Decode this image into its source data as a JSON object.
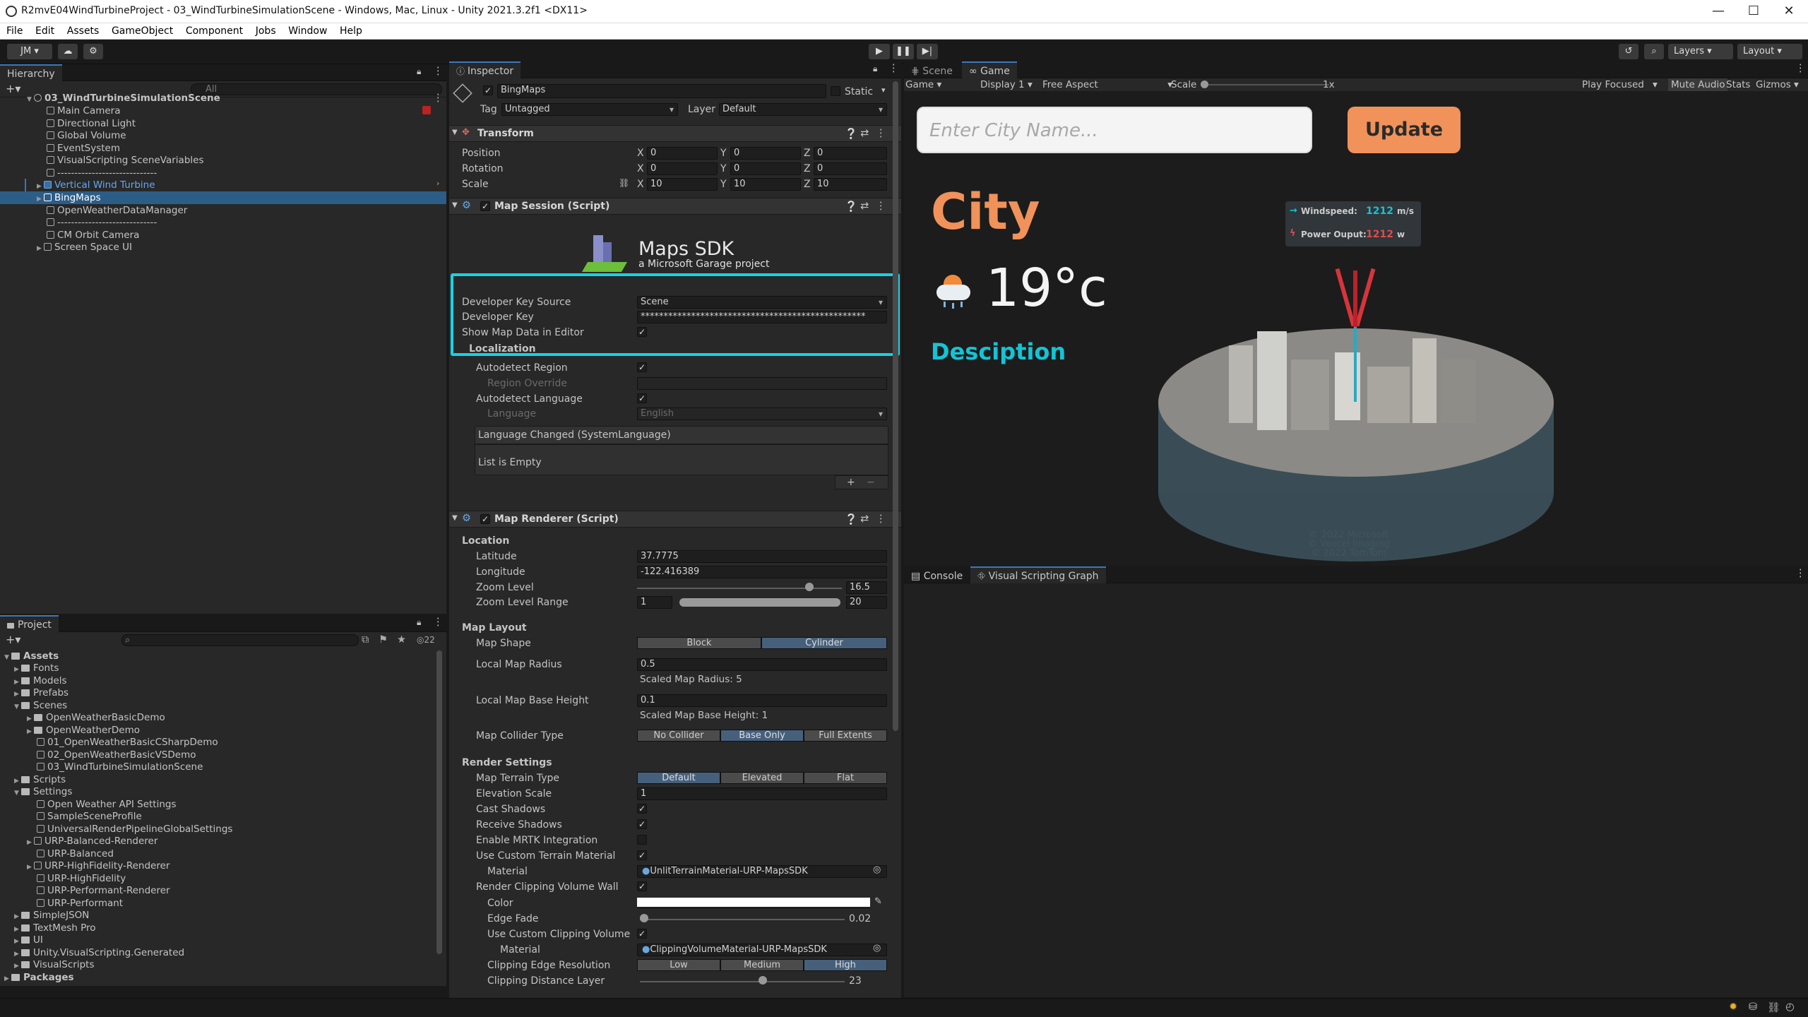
{
  "window": {
    "title": "R2mvE04WindTurbineProject - 03_WindTurbineSimulationScene - Windows, Mac, Linux - Unity 2021.3.2f1 <DX11>"
  },
  "menu": [
    "File",
    "Edit",
    "Assets",
    "GameObject",
    "Component",
    "Jobs",
    "Window",
    "Help"
  ],
  "toolbar": {
    "account": "JM",
    "layers": "Layers",
    "layout": "Layout"
  },
  "hierarchy": {
    "tab": "Hierarchy",
    "search_placeholder": "All",
    "scene": "03_WindTurbineSimulationScene",
    "items": [
      {
        "label": "Main Camera"
      },
      {
        "label": "Directional Light"
      },
      {
        "label": "Global Volume"
      },
      {
        "label": "EventSystem"
      },
      {
        "label": "VisualScripting SceneVariables"
      },
      {
        "label": "-----------------------------"
      },
      {
        "label": "Vertical Wind Turbine"
      },
      {
        "label": "BingMaps"
      },
      {
        "label": "OpenWeatherDataManager"
      },
      {
        "label": "-----------------------------"
      },
      {
        "label": "CM Orbit Camera"
      },
      {
        "label": "Screen Space UI"
      }
    ]
  },
  "project": {
    "tab": "Project",
    "count": "22",
    "items": [
      {
        "label": "Assets"
      },
      {
        "label": "Fonts"
      },
      {
        "label": "Models"
      },
      {
        "label": "Prefabs"
      },
      {
        "label": "Scenes"
      },
      {
        "label": "OpenWeatherBasicDemo"
      },
      {
        "label": "OpenWeatherDemo"
      },
      {
        "label": "01_OpenWeatherBasicCSharpDemo"
      },
      {
        "label": "02_OpenWeatherBasicVSDemo"
      },
      {
        "label": "03_WindTurbineSimulationScene"
      },
      {
        "label": "Scripts"
      },
      {
        "label": "Settings"
      },
      {
        "label": "Open Weather API Settings"
      },
      {
        "label": "SampleSceneProfile"
      },
      {
        "label": "UniversalRenderPipelineGlobalSettings"
      },
      {
        "label": "URP-Balanced-Renderer"
      },
      {
        "label": "URP-Balanced"
      },
      {
        "label": "URP-HighFidelity-Renderer"
      },
      {
        "label": "URP-HighFidelity"
      },
      {
        "label": "URP-Performant-Renderer"
      },
      {
        "label": "URP-Performant"
      },
      {
        "label": "SimpleJSON"
      },
      {
        "label": "TextMesh Pro"
      },
      {
        "label": "UI"
      },
      {
        "label": "Unity.VisualScripting.Generated"
      },
      {
        "label": "VisualScripts"
      },
      {
        "label": "Packages"
      }
    ]
  },
  "inspector": {
    "tab": "Inspector",
    "object_name": "BingMaps",
    "static_label": "Static",
    "tag_label": "Tag",
    "tag_value": "Untagged",
    "layer_label": "Layer",
    "layer_value": "Default",
    "transform": {
      "title": "Transform",
      "position": "Position",
      "rotation": "Rotation",
      "scale": "Scale",
      "x": "X",
      "y": "Y",
      "z": "Z",
      "pos": [
        "0",
        "0",
        "0"
      ],
      "rot": [
        "0",
        "0",
        "0"
      ],
      "scl": [
        "10",
        "10",
        "10"
      ]
    },
    "map_session": {
      "title": "Map Session (Script)",
      "sdk_title": "Maps SDK",
      "sdk_sub": "a Microsoft Garage project",
      "key_source_label": "Developer Key Source",
      "key_source": "Scene",
      "key_label": "Developer Key",
      "key_value": "*************************************************",
      "show_label": "Show Map Data in Editor",
      "localization": "Localization",
      "autodetect_region": "Autodetect Region",
      "region_override": "Region Override",
      "autodetect_language": "Autodetect Language",
      "language": "Language",
      "language_value": "English",
      "event_title": "Language Changed (SystemLanguage)",
      "event_empty": "List is Empty"
    },
    "map_renderer": {
      "title": "Map Renderer (Script)",
      "location": "Location",
      "lat_label": "Latitude",
      "lat": "37.7775",
      "lon_label": "Longitude",
      "lon": "-122.416389",
      "zoom_label": "Zoom Level",
      "zoom": "16.5",
      "zoom_level_fraction": 0.84,
      "range_label": "Zoom Level Range",
      "range_min": "1",
      "range_max": "20",
      "map_layout": "Map Layout",
      "shape_label": "Map Shape",
      "shapes": [
        "Block",
        "Cylinder"
      ],
      "radius_label": "Local Map Radius",
      "radius": "0.5",
      "scaled_radius": "Scaled Map Radius: 5",
      "base_label": "Local Map Base Height",
      "base": "0.1",
      "scaled_base": "Scaled Map Base Height: 1",
      "collider_label": "Map Collider Type",
      "colliders": [
        "No Collider",
        "Base Only",
        "Full Extents"
      ],
      "render_settings": "Render Settings",
      "terrain_label": "Map Terrain Type",
      "terrains": [
        "Default",
        "Elevated",
        "Flat"
      ],
      "elev_label": "Elevation Scale",
      "elev": "1",
      "cast": "Cast Shadows",
      "receive": "Receive Shadows",
      "mrtk": "Enable MRTK Integration",
      "custom_terrain": "Use Custom Terrain Material",
      "material_label": "Material",
      "material": "UnlitTerrainMaterial-URP-MapsSDK",
      "clip_wall": "Render Clipping Volume Wall",
      "color_label": "Color",
      "edge_label": "Edge Fade",
      "edge": "0.02",
      "edge_fraction": 0.02,
      "custom_clip": "Use Custom Clipping Volume Mate",
      "clip_material": "ClippingVolumeMaterial-URP-MapsSDK",
      "clip_res_label": "Clipping Edge Resolution",
      "clip_res": [
        "Low",
        "Medium",
        "High"
      ],
      "clip_dist_label": "Clipping Distance Layer",
      "clip_dist": "23",
      "clip_dist_fraction": 0.6
    }
  },
  "scene_tabs": {
    "scene": "Scene",
    "game": "Game"
  },
  "game_toolbar": {
    "mode": "Game",
    "display": "Display 1",
    "aspect": "Free Aspect",
    "scale_label": "Scale",
    "scale_value": "1x",
    "play_focused": "Play Focused",
    "mute": "Mute Audio",
    "stats": "Stats",
    "gizmos": "Gizmos"
  },
  "game_ui": {
    "placeholder": "Enter City Name...",
    "update": "Update",
    "city": "City",
    "temp": "19°c",
    "desc": "Desciption",
    "wind_label": "Windspeed:",
    "wind_value": "1212",
    "wind_unit": "m/s",
    "power_label": "Power Ouput:",
    "power_value": "1212",
    "power_unit": "w",
    "copyright": [
      "© 2022 Microsoft",
      "© Vexcel Imaging",
      "© 2022 TomTom"
    ]
  },
  "bottom_tabs": {
    "console": "Console",
    "vsgraph": "Visual Scripting Graph"
  },
  "colors": {
    "accent_orange": "#f0925a",
    "cyan": "#12c4d6",
    "selection": "#2c5d87",
    "highlight_box": "#16d3e4"
  }
}
